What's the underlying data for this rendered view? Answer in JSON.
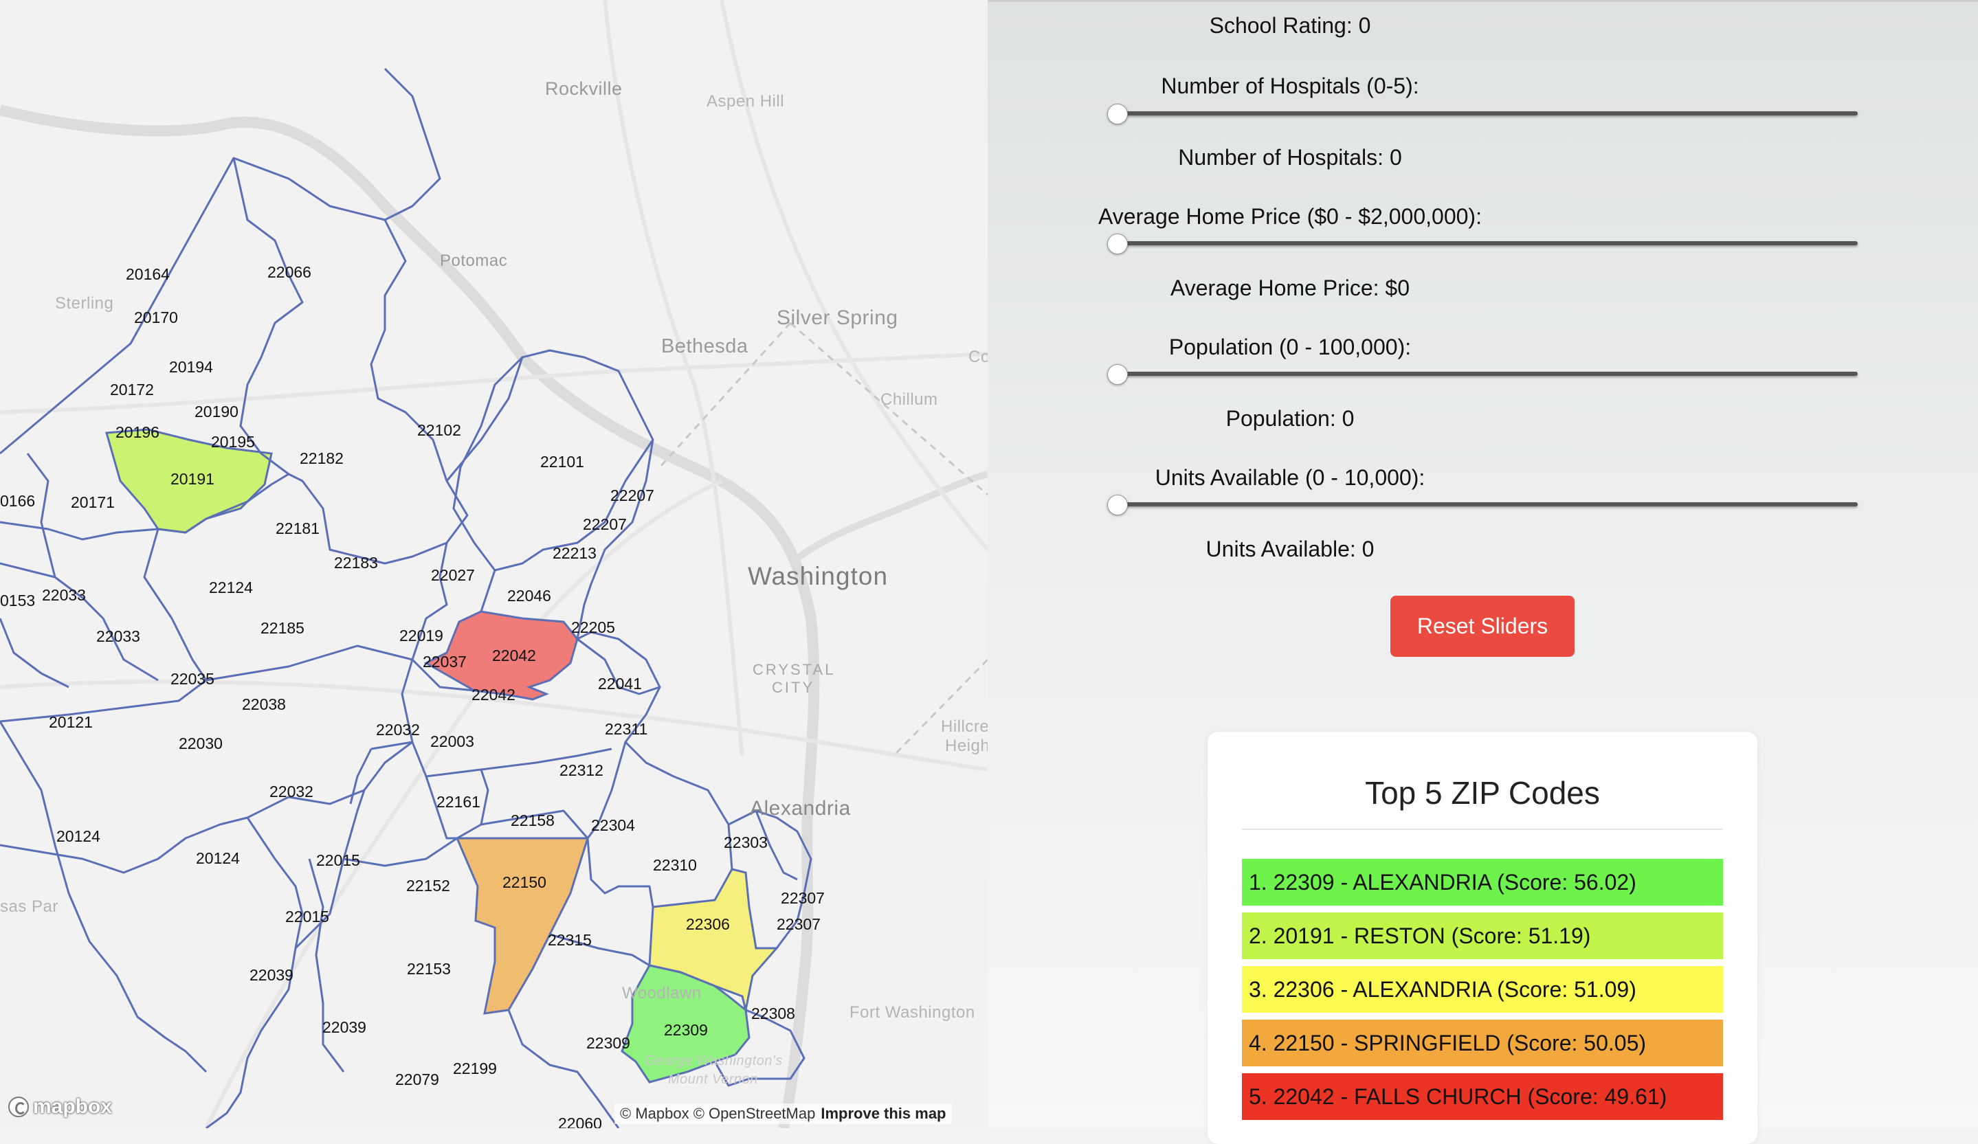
{
  "map": {
    "place_labels": {
      "rockville": "Rockville",
      "aspen_hill": "Aspen Hill",
      "potomac": "Potomac",
      "sterling": "Sterling",
      "silver_spring": "Silver Spring",
      "bethesda": "Bethesda",
      "chillum": "Chillum",
      "co": "Co",
      "washington": "Washington",
      "crystal": "CRYSTAL",
      "city": "CITY",
      "hillcrest": "Hillcre",
      "heights": "Heigh",
      "alexandria": "Alexandria",
      "woodlawn": "Woodlawn",
      "fort_washington": "Fort Washington",
      "george_washington": "George Washington's",
      "mount_vernon": "Mount Vernon",
      "manassas_park": "sas Par"
    },
    "zip_labels": [
      "20164",
      "22066",
      "20170",
      "20194",
      "20172",
      "20190",
      "20196",
      "20195",
      "20191",
      "22182",
      "22102",
      "22101",
      "20171",
      "0166",
      "22207",
      "22181",
      "22207",
      "22183",
      "22213",
      "22027",
      "22124",
      "22046",
      "0153",
      "22033",
      "22185",
      "22019",
      "22205",
      "22033",
      "22042",
      "22037",
      "22035",
      "22042",
      "22041",
      "22038",
      "20121",
      "22032",
      "22311",
      "22030",
      "22003",
      "22312",
      "22032",
      "22161",
      "22158",
      "22304",
      "20124",
      "22303",
      "20124",
      "22015",
      "22152",
      "22150",
      "22310",
      "22307",
      "22015",
      "22306",
      "22307",
      "22315",
      "22039",
      "22153",
      "22308",
      "22039",
      "22309",
      "22309",
      "22079",
      "22199",
      "22060"
    ],
    "highlight_colors": {
      "rank1": "#7ef26a",
      "rank2": "#c6f25a",
      "rank3": "#f5f070",
      "rank4": "#f0b660",
      "rank5": "#ee6f6a"
    },
    "attribution": "© Mapbox © OpenStreetMap",
    "improve_link": "Improve this map",
    "logo_text": "mapbox"
  },
  "controls": {
    "school_rating_value": "School Rating: 0",
    "hospitals_label": "Number of Hospitals (0-5):",
    "hospitals_value_text": "Number of Hospitals: 0",
    "hospitals_value": 0,
    "home_price_label": "Average Home Price ($0 - $2,000,000):",
    "home_price_value_text": "Average Home Price: $0",
    "home_price_value": 0,
    "population_label": "Population (0 - 100,000):",
    "population_value_text": "Population: 0",
    "population_value": 0,
    "units_label": "Units Available (0 - 10,000):",
    "units_value_text": "Units Available: 0",
    "units_value": 0,
    "reset_label": "Reset Sliders"
  },
  "top5": {
    "title": "Top 5 ZIP Codes",
    "items": [
      {
        "text": "1. 22309 - ALEXANDRIA (Score: 56.02)",
        "color": "#6ef24c"
      },
      {
        "text": "2. 20191 - RESTON (Score: 51.19)",
        "color": "#c2f54a"
      },
      {
        "text": "3. 22306 - ALEXANDRIA (Score: 51.09)",
        "color": "#fafa50"
      },
      {
        "text": "4. 22150 - SPRINGFIELD (Score: 50.05)",
        "color": "#f2a83c"
      },
      {
        "text": "5. 22042 - FALLS CHURCH (Score: 49.61)",
        "color": "#ec3424"
      }
    ]
  }
}
